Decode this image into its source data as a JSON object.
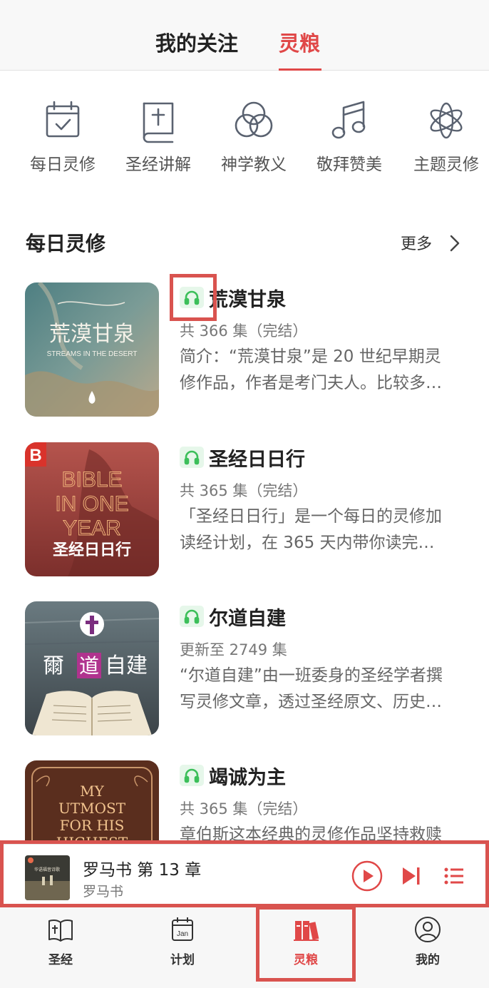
{
  "top_tabs": {
    "follow": "我的关注",
    "manna": "灵粮"
  },
  "categories": [
    {
      "label": "每日灵修",
      "icon": "calendar-check-icon"
    },
    {
      "label": "圣经讲解",
      "icon": "bible-cross-icon"
    },
    {
      "label": "神学教义",
      "icon": "three-circles-icon"
    },
    {
      "label": "敬拜赞美",
      "icon": "music-note-icon"
    },
    {
      "label": "主题灵修",
      "icon": "flower-icon"
    }
  ],
  "section": {
    "title": "每日灵修",
    "more": "更多"
  },
  "items": [
    {
      "title": "荒漠甘泉",
      "meta": "共 366 集（完结）",
      "desc1": "简介：“荒漠甘泉”是 20 世纪早期灵",
      "desc2": "修作品，作者是考门夫人。比较多…",
      "cover_text": "荒漠甘泉",
      "cover_sub": "STREAMS IN THE DESERT"
    },
    {
      "title": "圣经日日行",
      "meta": "共 365 集（完结）",
      "desc1": "「圣经日日行」是一个每日的灵修加",
      "desc2": "读经计划，在 365 天内带你读完…",
      "cover_l1": "BIBLE",
      "cover_l2": "IN ONE",
      "cover_l3": "YEAR",
      "cover_cn": "圣经日日行",
      "cover_logo": "B"
    },
    {
      "title": "尔道自建",
      "meta": "更新至 2749 集",
      "desc1": "“尔道自建”由一班委身的圣经学者撰",
      "desc2": "写灵修文章，透过圣经原文、历史…",
      "cover_a": "爾",
      "cover_b": "道",
      "cover_c": "自建"
    },
    {
      "title": "竭诚为主",
      "meta": "共 365 集（完结）",
      "desc1": "章伯斯这本经典的灵修作品坚持救赎",
      "desc2": "",
      "cover_l1": "MY",
      "cover_l2": "UTMOST",
      "cover_l3": "FOR HIS",
      "cover_l4": "HIGHEST"
    }
  ],
  "player": {
    "title": "罗马书 第 13 章",
    "subtitle": "罗马书",
    "thumb_text": "华语福音诗歌"
  },
  "bottom_nav": [
    {
      "label": "圣经",
      "icon": "bible-icon"
    },
    {
      "label": "计划",
      "icon": "calendar-jan-icon",
      "icon_text": "Jan"
    },
    {
      "label": "灵粮",
      "icon": "books-icon",
      "active": true
    },
    {
      "label": "我的",
      "icon": "profile-icon"
    }
  ],
  "colors": {
    "accent": "#e04848",
    "headphone_bg": "#e6f7ea",
    "headphone": "#3cbf5a",
    "annotation": "#d9534f"
  }
}
